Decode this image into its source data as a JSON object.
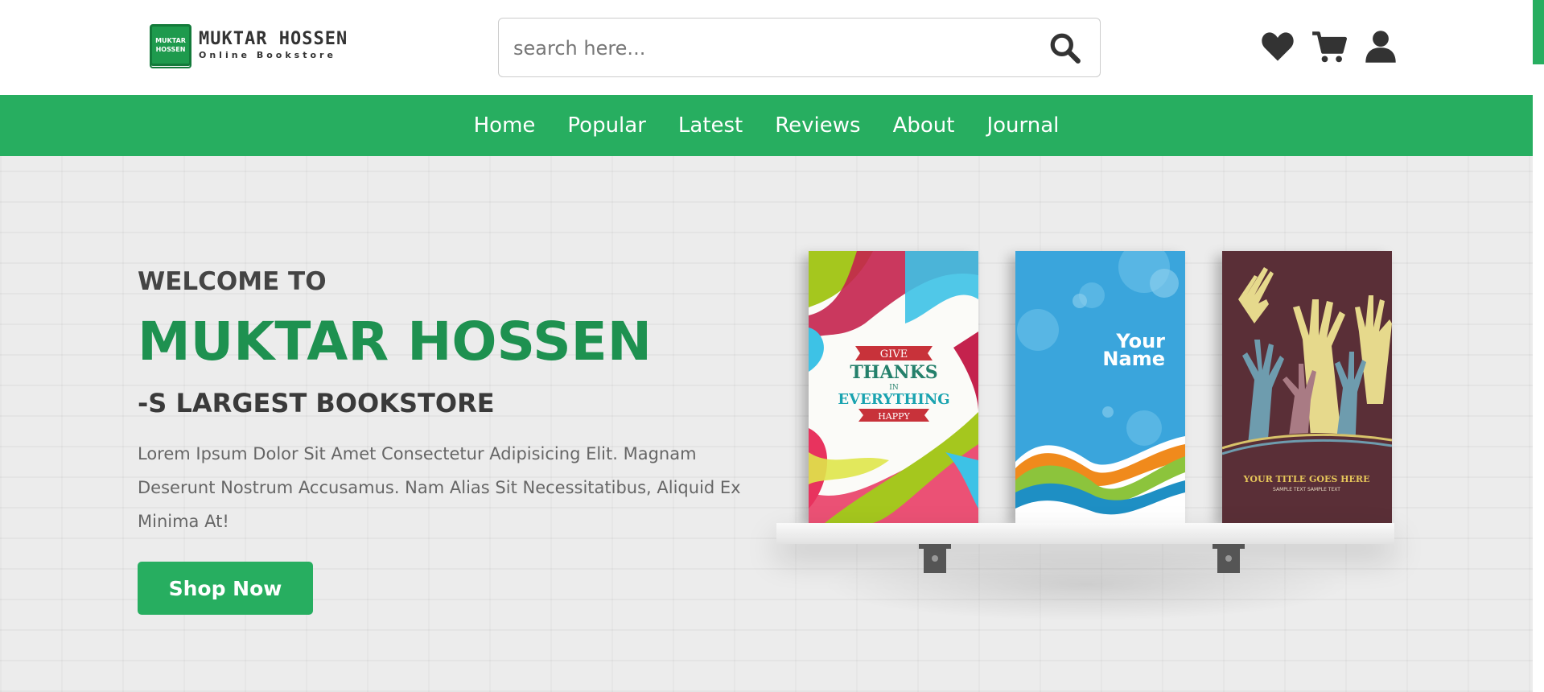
{
  "header": {
    "logo": {
      "badge_line1": "MUKTAR",
      "badge_line2": "HOSSEN",
      "title": "MUKTAR HOSSEN",
      "subtitle": "Online Bookstore"
    },
    "search": {
      "placeholder": "search here...",
      "value": ""
    },
    "icons": [
      "search-icon",
      "heart-icon",
      "cart-icon",
      "user-icon"
    ]
  },
  "nav": {
    "items": [
      {
        "label": "Home"
      },
      {
        "label": "Popular"
      },
      {
        "label": "Latest"
      },
      {
        "label": "Reviews"
      },
      {
        "label": "About"
      },
      {
        "label": "Journal"
      }
    ]
  },
  "hero": {
    "welcome": "WELCOME TO",
    "brand": "MUKTAR HOSSEN",
    "tagline": "-S LARGEST BOOKSTORE",
    "description": "Lorem Ipsum Dolor Sit Amet Consectetur Adipisicing Elit. Magnam Deserunt Nostrum Accusamus. Nam Alias Sit Necessitatibus, Aliquid Ex Minima At!",
    "cta_label": "Shop Now"
  },
  "books": [
    {
      "line1": "GIVE",
      "line2": "THANKS",
      "line3": "IN",
      "line4": "EVERYTHING",
      "line5": "HAPPY"
    },
    {
      "line1": "Your",
      "line2": "Name"
    },
    {
      "line1": "YOUR TITLE GOES HERE",
      "line2": "SAMPLE TEXT SAMPLE TEXT"
    }
  ],
  "colors": {
    "accent": "#27ae60",
    "brand_text": "#1e9150",
    "dark_text": "#333333"
  }
}
